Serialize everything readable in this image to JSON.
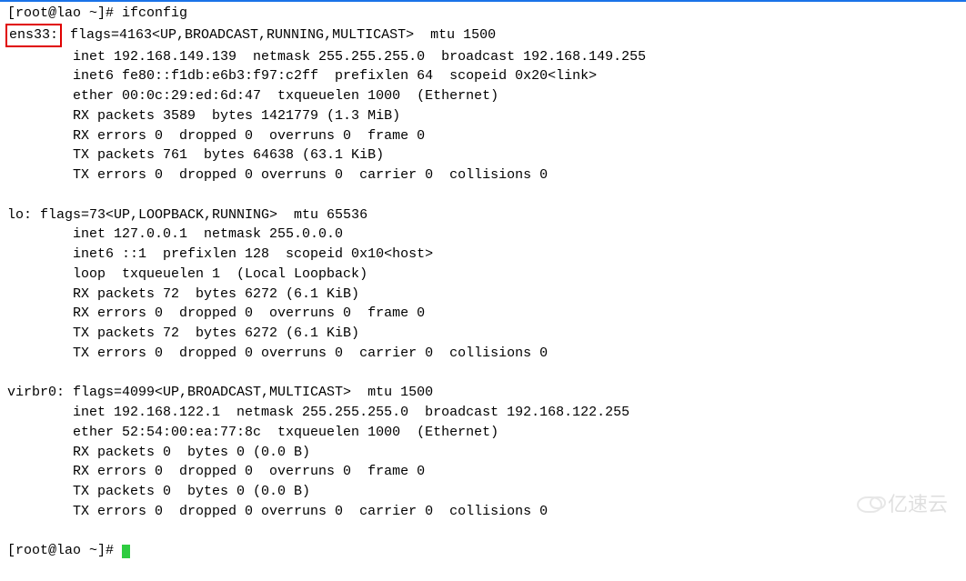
{
  "prompt1": "[root@lao ~]# ifconfig",
  "ens33": {
    "name": "ens33:",
    "flags": " flags=4163<UP,BROADCAST,RUNNING,MULTICAST>  mtu 1500",
    "inet": "        inet 192.168.149.139  netmask 255.255.255.0  broadcast 192.168.149.255",
    "inet6": "        inet6 fe80::f1db:e6b3:f97:c2ff  prefixlen 64  scopeid 0x20<link>",
    "ether": "        ether 00:0c:29:ed:6d:47  txqueuelen 1000  (Ethernet)",
    "rxp": "        RX packets 3589  bytes 1421779 (1.3 MiB)",
    "rxe": "        RX errors 0  dropped 0  overruns 0  frame 0",
    "txp": "        TX packets 761  bytes 64638 (63.1 KiB)",
    "txe": "        TX errors 0  dropped 0 overruns 0  carrier 0  collisions 0"
  },
  "lo": {
    "header": "lo: flags=73<UP,LOOPBACK,RUNNING>  mtu 65536",
    "inet": "        inet 127.0.0.1  netmask 255.0.0.0",
    "inet6": "        inet6 ::1  prefixlen 128  scopeid 0x10<host>",
    "loop": "        loop  txqueuelen 1  (Local Loopback)",
    "rxp": "        RX packets 72  bytes 6272 (6.1 KiB)",
    "rxe": "        RX errors 0  dropped 0  overruns 0  frame 0",
    "txp": "        TX packets 72  bytes 6272 (6.1 KiB)",
    "txe": "        TX errors 0  dropped 0 overruns 0  carrier 0  collisions 0"
  },
  "virbr0": {
    "header": "virbr0: flags=4099<UP,BROADCAST,MULTICAST>  mtu 1500",
    "inet": "        inet 192.168.122.1  netmask 255.255.255.0  broadcast 192.168.122.255",
    "ether": "        ether 52:54:00:ea:77:8c  txqueuelen 1000  (Ethernet)",
    "rxp": "        RX packets 0  bytes 0 (0.0 B)",
    "rxe": "        RX errors 0  dropped 0  overruns 0  frame 0",
    "txp": "        TX packets 0  bytes 0 (0.0 B)",
    "txe": "        TX errors 0  dropped 0 overruns 0  carrier 0  collisions 0"
  },
  "prompt2": "[root@lao ~]# ",
  "watermark": "亿速云"
}
